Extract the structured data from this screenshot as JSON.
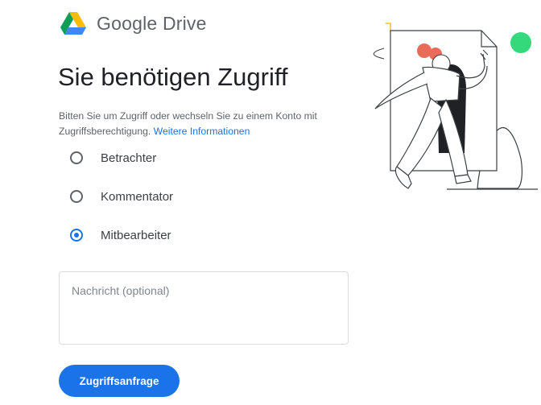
{
  "header": {
    "logo_icon": "google-drive-logo",
    "brand": "Google Drive"
  },
  "main": {
    "title": "Sie benötigen Zugriff",
    "description": "Bitten Sie um Zugriff oder wechseln Sie zu einem Konto mit Zugriffsberechtigung.",
    "learn_more_link": "Weitere Informationen"
  },
  "roles": {
    "options": [
      {
        "label": "Betrachter",
        "selected": false
      },
      {
        "label": "Kommentator",
        "selected": false
      },
      {
        "label": "Mitbearbeiter",
        "selected": true
      }
    ]
  },
  "message": {
    "placeholder": "Nachricht (optional)",
    "value": ""
  },
  "actions": {
    "request_label": "Zugriffsanfrage"
  },
  "illustration": {
    "icon": "person-leaving-document-illustration"
  },
  "colors": {
    "accent": "#1a73e8",
    "text_primary": "#202124",
    "text_secondary": "#5f6368",
    "illustration_green": "#34d97b",
    "illustration_red": "#ea6b5a"
  }
}
